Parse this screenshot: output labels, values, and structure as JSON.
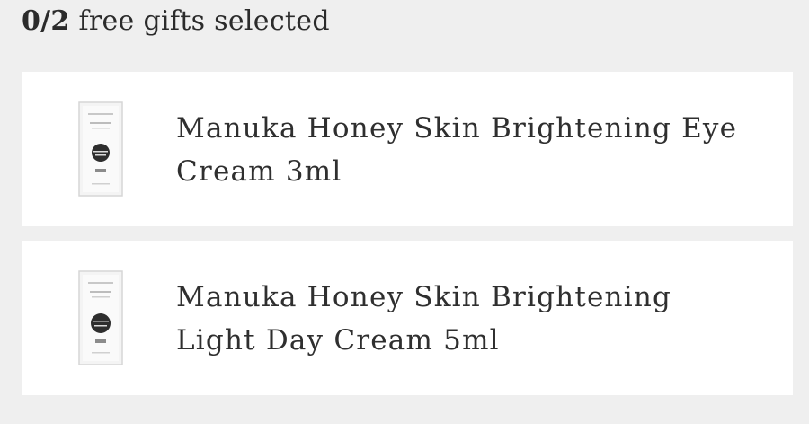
{
  "header": {
    "count": "0/2",
    "label": "free gifts selected"
  },
  "gifts": [
    {
      "name": "Manuka Honey Skin Brightening Eye Cream 3ml",
      "icon": "product-sachet-icon"
    },
    {
      "name": "Manuka Honey Skin Brightening Light Day Cream 5ml",
      "icon": "product-sachet-icon"
    }
  ]
}
